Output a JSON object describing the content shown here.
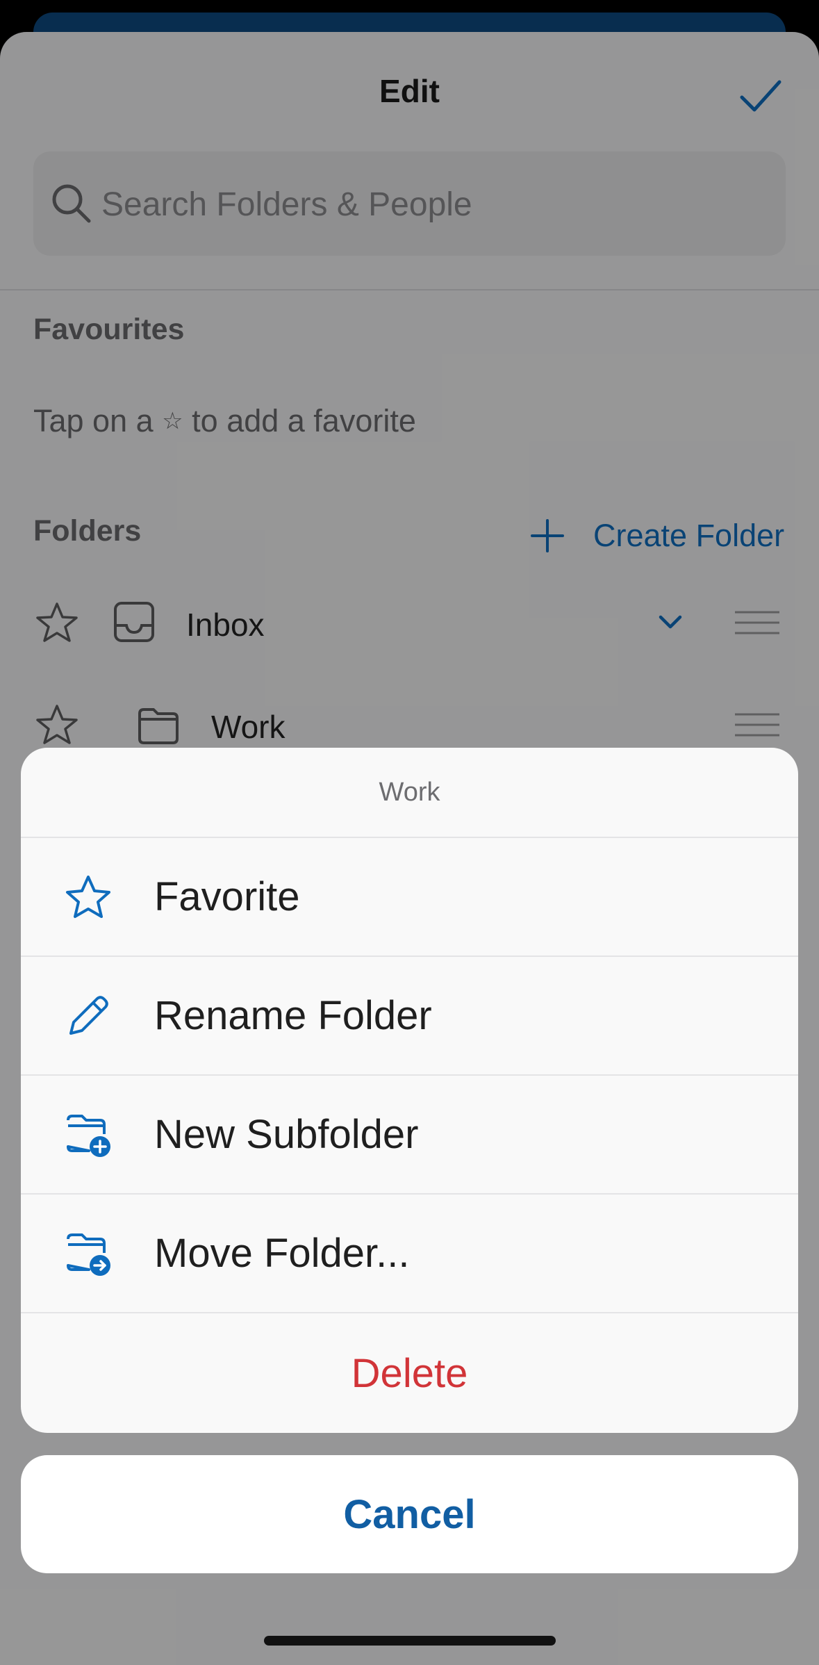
{
  "header": {
    "title": "Edit"
  },
  "search": {
    "placeholder": "Search Folders & People"
  },
  "favourites": {
    "label": "Favourites",
    "hint_before": "Tap on a",
    "hint_star": "☆",
    "hint_after": "to add a favorite"
  },
  "folders": {
    "label": "Folders",
    "create_label": "Create Folder",
    "items": [
      {
        "name": "Inbox"
      },
      {
        "name": "Work"
      }
    ]
  },
  "action_sheet": {
    "title": "Work",
    "items": [
      {
        "label": "Favorite",
        "icon": "star-icon"
      },
      {
        "label": "Rename Folder",
        "icon": "pencil-icon"
      },
      {
        "label": "New Subfolder",
        "icon": "folder-add-icon"
      },
      {
        "label": "Move Folder...",
        "icon": "folder-move-icon"
      }
    ],
    "delete_label": "Delete",
    "cancel_label": "Cancel"
  },
  "colors": {
    "accent": "#0f6cbd",
    "destructive": "#d13438",
    "cancel_text": "#115ea3"
  }
}
